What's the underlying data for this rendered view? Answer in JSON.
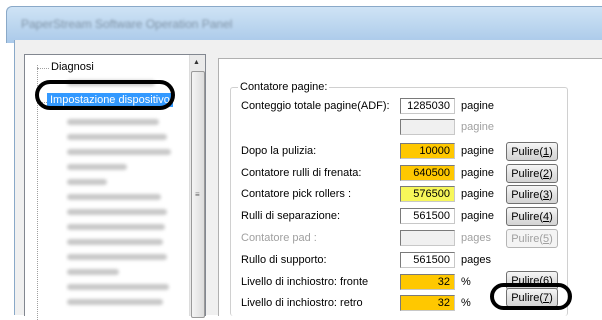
{
  "window": {
    "title": "PaperStream Software Operation Panel"
  },
  "tree": {
    "root_label": "Diagnosi",
    "selected_label": "Impostazione dispositivo",
    "blurred_item_count_note": ""
  },
  "counters": {
    "group_title": "Contatore pagine:",
    "rows": [
      {
        "label": "Conteggio totale pagine(ADF):",
        "value": "1285030",
        "unit": "pagine",
        "button": ""
      },
      {
        "label": "",
        "value": "",
        "unit": "pagine",
        "button": ""
      },
      {
        "label": "Dopo la pulizia:",
        "value": "10000",
        "unit": "pagine",
        "button": "Pulire(1)"
      },
      {
        "label": "Contatore rulli di frenata:",
        "value": "640500",
        "unit": "pagine",
        "button": "Pulire(2)"
      },
      {
        "label": "Contatore pick rollers :",
        "value": "576500",
        "unit": "pagine",
        "button": "Pulire(3)"
      },
      {
        "label": "Rulli di separazione:",
        "value": "561500",
        "unit": "pagine",
        "button": "Pulire(4)"
      },
      {
        "label": "Contatore pad :",
        "value": "",
        "unit": "pages",
        "button": "Pulire(5)"
      },
      {
        "label": "Rullo di supporto:",
        "value": "561500",
        "unit": "pages",
        "button": ""
      },
      {
        "label": "Livello di inchiostro: fronte",
        "value": "32",
        "unit": "%",
        "button": "Pulire(6)"
      },
      {
        "label": "Livello di inchiostro: retro",
        "value": "32",
        "unit": "%",
        "button": "Pulire(7)"
      }
    ]
  }
}
